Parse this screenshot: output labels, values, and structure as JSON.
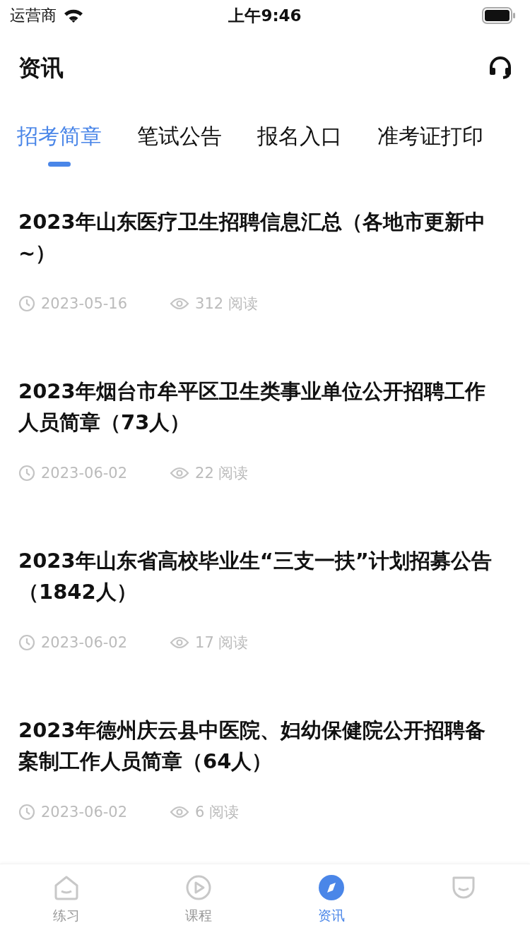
{
  "status_bar": {
    "carrier": "运营商",
    "time": "上午9:46"
  },
  "header": {
    "title": "资讯"
  },
  "tabs": [
    {
      "label": "招考简章",
      "selected": true
    },
    {
      "label": "笔试公告",
      "selected": false
    },
    {
      "label": "报名入口",
      "selected": false
    },
    {
      "label": "准考证打印",
      "selected": false
    }
  ],
  "articles": [
    {
      "title": "2023年山东医疗卫生招聘信息汇总（各地市更新中~）",
      "date": "2023-05-16",
      "reads": "312 阅读"
    },
    {
      "title": "2023年烟台市牟平区卫生类事业单位公开招聘工作人员简章（73人）",
      "date": "2023-06-02",
      "reads": "22 阅读"
    },
    {
      "title": "2023年山东省高校毕业生“三支一扶”计划招募公告（1842人）",
      "date": "2023-06-02",
      "reads": "17 阅读"
    },
    {
      "title": "2023年德州庆云县中医院、妇幼保健院公开招聘备案制工作人员简章（64人）",
      "date": "2023-06-02",
      "reads": "6 阅读"
    }
  ],
  "tab_bar": [
    {
      "kind": "practice",
      "label": "练习",
      "selected": false
    },
    {
      "kind": "course",
      "label": "课程",
      "selected": false
    },
    {
      "kind": "news",
      "label": "资讯",
      "selected": true
    },
    {
      "kind": "mine",
      "selected": false
    }
  ]
}
